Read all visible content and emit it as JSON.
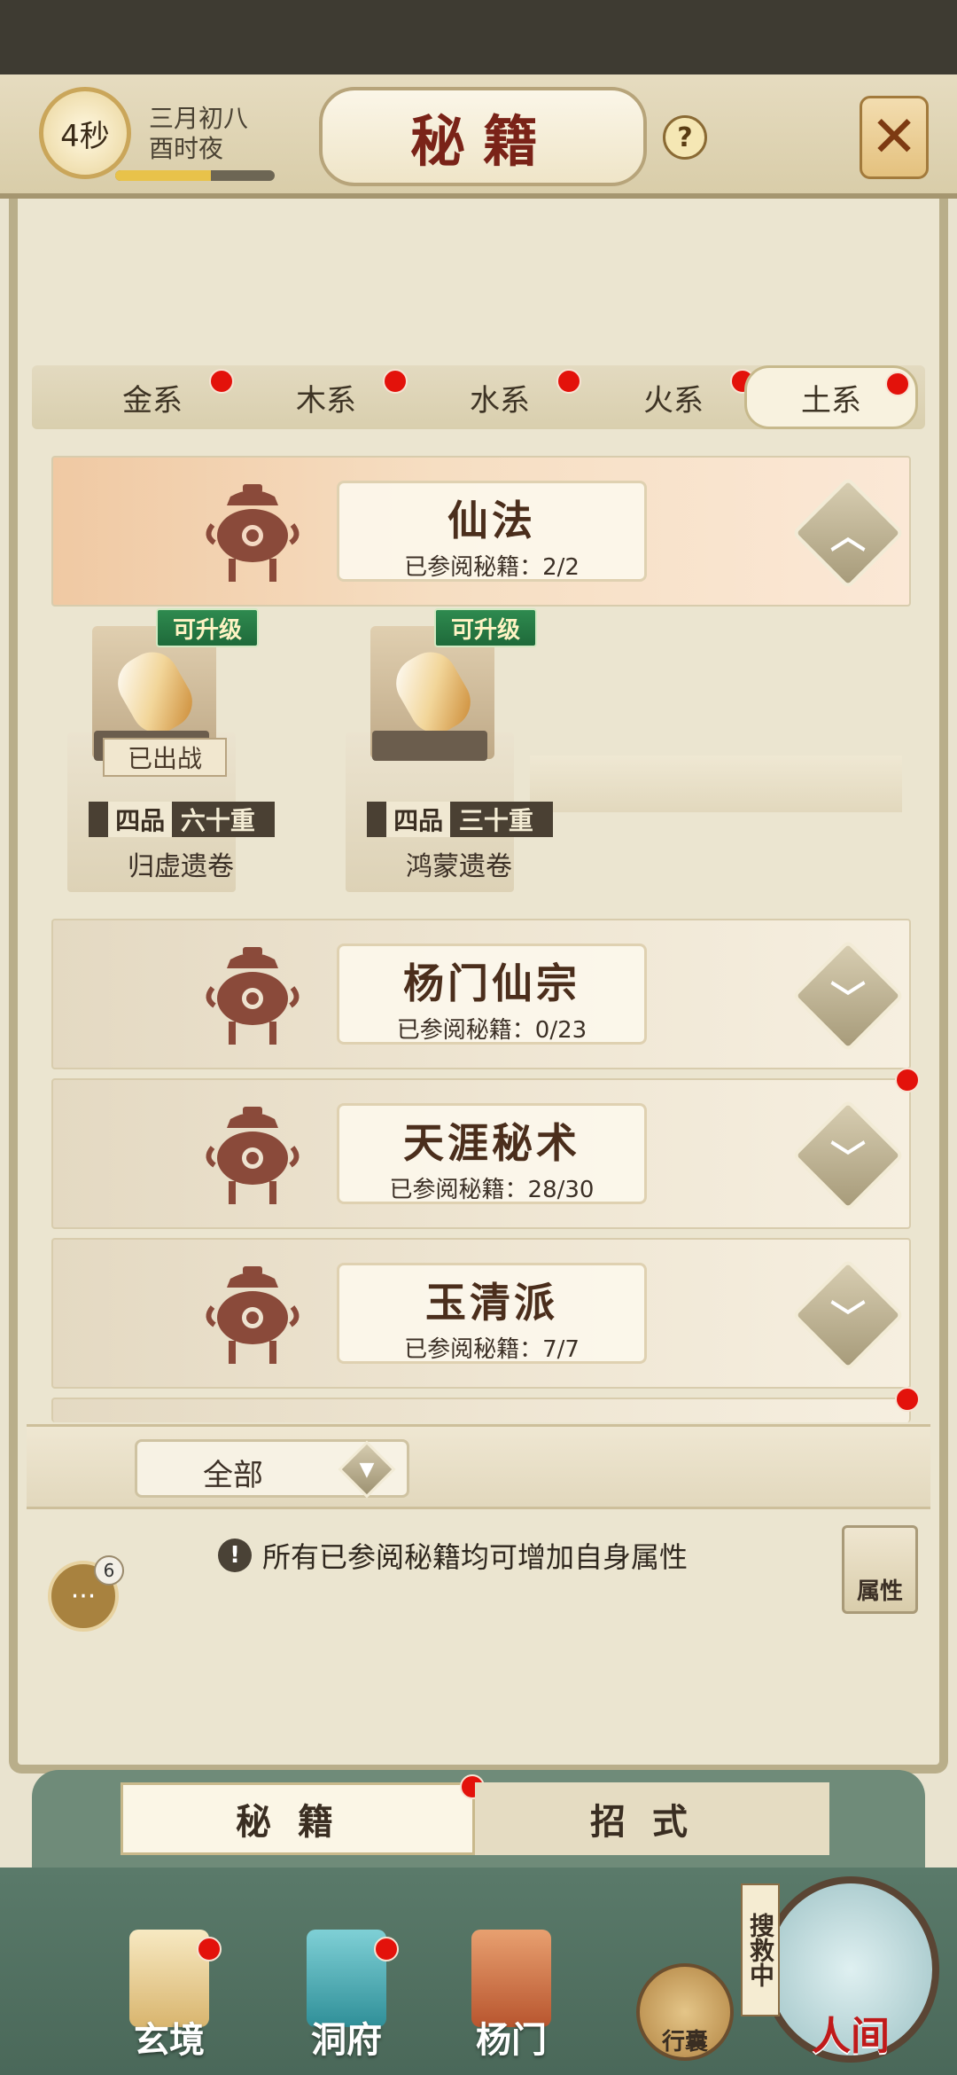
{
  "header": {
    "timer": "4秒",
    "date_line1": "三月初八",
    "date_line2": "酉时夜",
    "title": "秘籍",
    "help_icon": "question-icon",
    "close_icon": "close-icon"
  },
  "element_tabs": [
    {
      "label": "金系",
      "has_dot": true
    },
    {
      "label": "木系",
      "has_dot": true
    },
    {
      "label": "水系",
      "has_dot": true
    },
    {
      "label": "火系",
      "has_dot": true
    },
    {
      "label": "土系",
      "has_dot": true,
      "active": true
    }
  ],
  "categories": [
    {
      "name": "仙法",
      "progress": "已参阅秘籍：2/2",
      "expanded": true
    },
    {
      "name": "杨门仙宗",
      "progress": "已参阅秘籍：0/23"
    },
    {
      "name": "天涯秘术",
      "progress": "已参阅秘籍：28/30",
      "has_dot": true
    },
    {
      "name": "玉清派",
      "progress": "已参阅秘籍：7/7"
    }
  ],
  "books": [
    {
      "badge": "可升级",
      "status": "已出战",
      "grade_prefix": "四品",
      "grade_suffix": "六十重",
      "name": "归虚遗卷"
    },
    {
      "badge": "可升级",
      "grade_prefix": "四品",
      "grade_suffix": "三十重",
      "name": "鸿蒙遗卷"
    }
  ],
  "filter": {
    "label": "全部"
  },
  "info": {
    "text": "所有已参阅秘籍均可增加自身属性"
  },
  "chat": {
    "count": "6"
  },
  "attributes_button": "属性",
  "bottom_tabs": [
    {
      "label": "秘籍",
      "active": true,
      "has_dot": true
    },
    {
      "label": "招式"
    }
  ],
  "nav": [
    {
      "label": "玄境",
      "has_dot": true
    },
    {
      "label": "洞府",
      "has_dot": true
    },
    {
      "label": "杨门"
    },
    {
      "label": "行囊"
    },
    {
      "label": "人间"
    }
  ],
  "searching_label": "搜救中",
  "colors": {
    "accent_red": "#e3120b",
    "title_red": "#7a2318",
    "badge_green": "#1f6a3a"
  }
}
